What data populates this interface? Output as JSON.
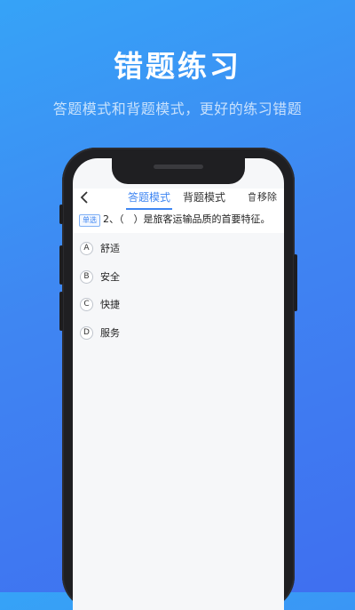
{
  "promo": {
    "title": "错题练习",
    "subtitle": "答题模式和背题模式，更好的练习错题"
  },
  "header": {
    "back_icon": "chevron-left-icon",
    "tabs": [
      {
        "label": "答题模式",
        "active": true
      },
      {
        "label": "背题模式",
        "active": false
      }
    ],
    "remove_label": "移除",
    "remove_icon": "trash-icon",
    "accent_color": "#3f86f2"
  },
  "question": {
    "type_tag": "单选",
    "text": "2、（　）是旅客运输品质的首要特征。"
  },
  "options": [
    {
      "letter": "A",
      "text": "舒适"
    },
    {
      "letter": "B",
      "text": "安全"
    },
    {
      "letter": "C",
      "text": "快捷"
    },
    {
      "letter": "D",
      "text": "服务"
    }
  ]
}
